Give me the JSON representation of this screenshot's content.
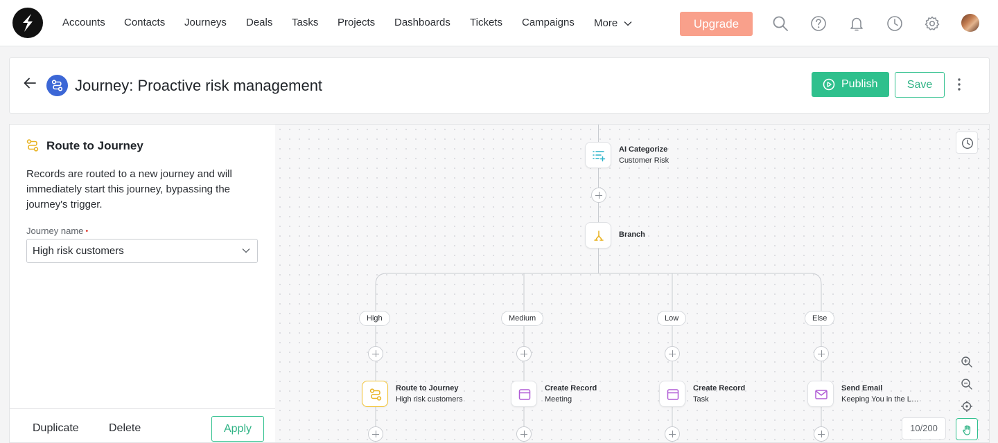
{
  "nav": {
    "items": [
      "Accounts",
      "Contacts",
      "Journeys",
      "Deals",
      "Tasks",
      "Projects",
      "Dashboards",
      "Tickets",
      "Campaigns",
      "More"
    ],
    "upgrade_label": "Upgrade",
    "upgrade_color": "#f9a08b",
    "icons": [
      "search-icon",
      "help-icon",
      "bell-icon",
      "clock-icon",
      "gear-icon"
    ]
  },
  "header": {
    "title": "Journey: Proactive risk management",
    "publish_label": "Publish",
    "save_label": "Save",
    "accent_color": "#2fc08d"
  },
  "panel": {
    "title": "Route to Journey",
    "description": "Records are routed to a new journey and will immediately start this journey, bypassing the journey's trigger.",
    "field_label": "Journey name",
    "required_mark": "•",
    "field_value": "High risk customers",
    "duplicate_label": "Duplicate",
    "delete_label": "Delete",
    "apply_label": "Apply"
  },
  "canvas": {
    "nodes": {
      "ai_categorize": {
        "title": "AI Categorize",
        "subtitle": "Customer Risk"
      },
      "branch": {
        "title": "Branch"
      }
    },
    "branches": [
      {
        "label": "High",
        "node_title": "Route to Journey",
        "node_subtitle": "High risk customers",
        "icon": "route-icon",
        "selected": true
      },
      {
        "label": "Medium",
        "node_title": "Create Record",
        "node_subtitle": "Meeting",
        "icon": "record-icon"
      },
      {
        "label": "Low",
        "node_title": "Create Record",
        "node_subtitle": "Task",
        "icon": "record-icon"
      },
      {
        "label": "Else",
        "node_title": "Send Email",
        "node_subtitle": "Keeping You in the L…",
        "icon": "mail-icon"
      }
    ],
    "zoom_counter": "10/200"
  }
}
